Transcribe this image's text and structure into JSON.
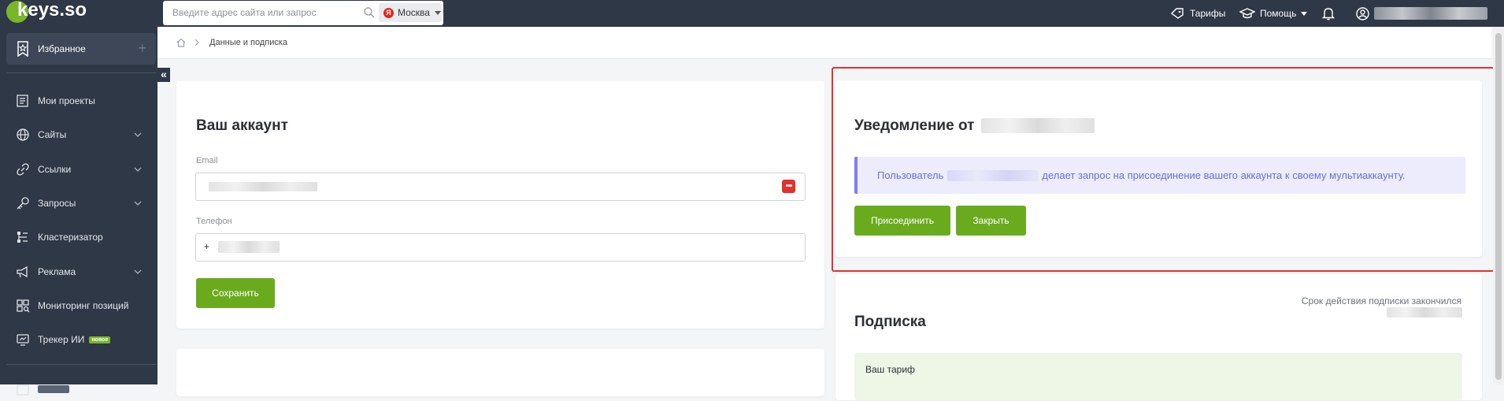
{
  "brand": {
    "logo_text": "keys.so",
    "accent": "#7ab52a",
    "dark": "#2f3846"
  },
  "search": {
    "placeholder": "Введите адрес сайта или запрос",
    "value": "",
    "region": "Москва",
    "region_badge": "Я"
  },
  "header": {
    "tariffs": "Тарифы",
    "help": "Помощь"
  },
  "sidebar": {
    "favorites": "Избранное",
    "items": [
      {
        "label": "Мои проекты",
        "icon": "projects-icon",
        "has_chevron": false
      },
      {
        "label": "Сайты",
        "icon": "globe-icon",
        "has_chevron": true
      },
      {
        "label": "Ссылки",
        "icon": "link-icon",
        "has_chevron": true
      },
      {
        "label": "Запросы",
        "icon": "key-icon",
        "has_chevron": true
      },
      {
        "label": "Кластеризатор",
        "icon": "cluster-icon",
        "has_chevron": false
      },
      {
        "label": "Реклама",
        "icon": "megaphone-icon",
        "has_chevron": true
      },
      {
        "label": "Мониторинг позиций",
        "icon": "monitoring-icon",
        "has_chevron": false
      },
      {
        "label": "Трекер ИИ",
        "icon": "tracker-icon",
        "has_chevron": false,
        "badge": "новое"
      }
    ]
  },
  "breadcrumb": {
    "current": "Данные и подписка"
  },
  "account": {
    "title": "Ваш аккаунт",
    "email_label": "Email",
    "phone_label": "Телефон",
    "phone_prefix": "+",
    "save": "Сохранить"
  },
  "notification": {
    "title": "Уведомление от",
    "text_prefix": "Пользователь",
    "text_suffix": "делает запрос на присоединение вашего аккаунта к своему мультиаккаунту.",
    "join": "Присоединить",
    "close": "Закрыть"
  },
  "subscription": {
    "title": "Подписка",
    "expired": "Срок действия подписки закончился",
    "your_tariff": "Ваш тариф"
  }
}
